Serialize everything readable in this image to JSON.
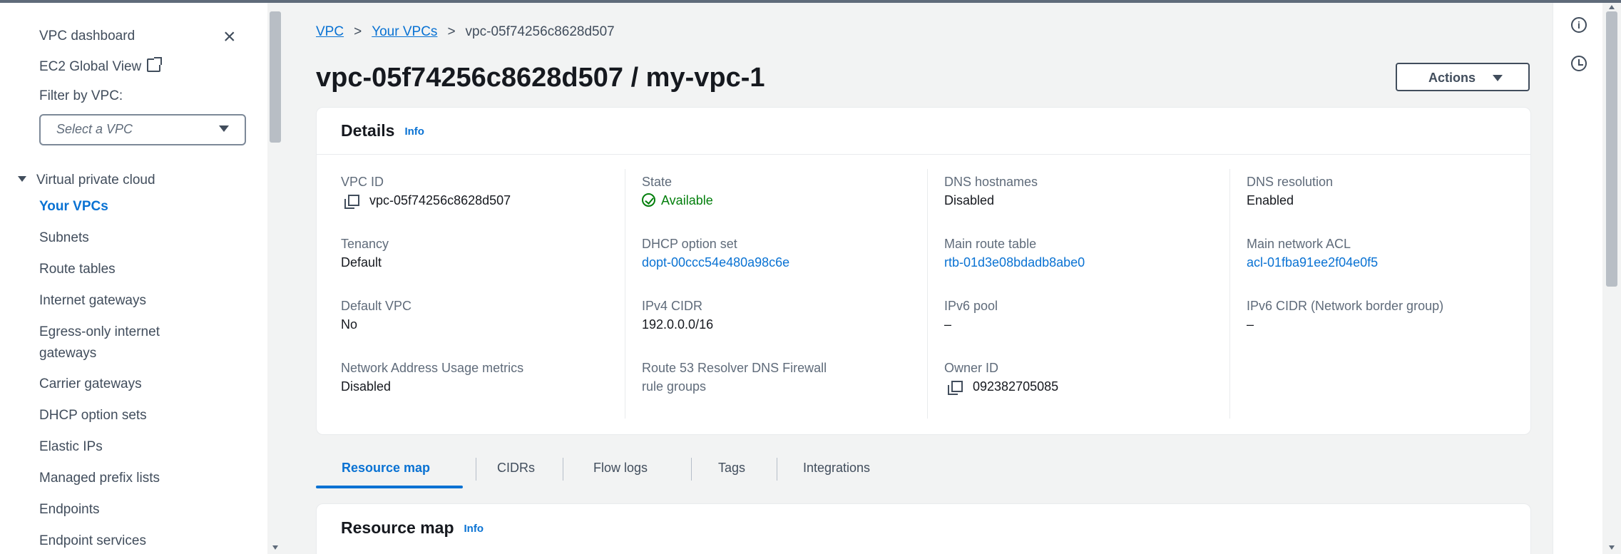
{
  "sidebar": {
    "dashboard_label": "VPC dashboard",
    "ec2_global_view_label": "EC2 Global View",
    "filter_label": "Filter by VPC:",
    "filter_select_value": "Select a VPC",
    "section_label": "Virtual private cloud",
    "items": [
      {
        "label": "Your VPCs",
        "active": true
      },
      {
        "label": "Subnets"
      },
      {
        "label": "Route tables"
      },
      {
        "label": "Internet gateways"
      },
      {
        "label": "Egress-only internet"
      },
      {
        "label": "gateways"
      },
      {
        "label": "Carrier gateways"
      },
      {
        "label": "DHCP option sets"
      },
      {
        "label": "Elastic IPs"
      },
      {
        "label": "Managed prefix lists"
      },
      {
        "label": "Endpoints"
      },
      {
        "label": "Endpoint services"
      }
    ]
  },
  "breadcrumb": {
    "items": [
      "VPC",
      "Your VPCs",
      "vpc-05f74256c8628d507"
    ],
    "separator": ">"
  },
  "page": {
    "title": "vpc-05f74256c8628d507 / my-vpc-1",
    "actions_label": "Actions"
  },
  "details": {
    "title": "Details",
    "info_label": "Info",
    "fields": {
      "vpc_id": {
        "label": "VPC ID",
        "value": "vpc-05f74256c8628d507"
      },
      "state": {
        "label": "State",
        "value": "Available"
      },
      "dns_hostnames": {
        "label": "DNS hostnames",
        "value": "Disabled"
      },
      "dns_resolution": {
        "label": "DNS resolution",
        "value": "Enabled"
      },
      "tenancy": {
        "label": "Tenancy",
        "value": "Default"
      },
      "dhcp_option_set": {
        "label": "DHCP option set",
        "value": "dopt-00ccc54e480a98c6e"
      },
      "main_route_table": {
        "label": "Main route table",
        "value": "rtb-01d3e08bdadb8abe0"
      },
      "main_network_acl": {
        "label": "Main network ACL",
        "value": "acl-01fba91ee2f04e0f5"
      },
      "default_vpc": {
        "label": "Default VPC",
        "value": "No"
      },
      "ipv4_cidr": {
        "label": "IPv4 CIDR",
        "value": "192.0.0.0/16"
      },
      "ipv6_pool": {
        "label": "IPv6 pool",
        "value": "–"
      },
      "ipv6_cidr": {
        "label": "IPv6 CIDR (Network border group)",
        "value": "–"
      },
      "nau_metrics": {
        "label": "Network Address Usage metrics",
        "value": "Disabled"
      },
      "route53_firewall": {
        "label_line1": "Route 53 Resolver DNS Firewall",
        "label_line2": "rule groups"
      },
      "owner_id": {
        "label": "Owner ID",
        "value": "092382705085"
      }
    }
  },
  "tabs": [
    {
      "label": "Resource map",
      "active": true
    },
    {
      "label": "CIDRs"
    },
    {
      "label": "Flow logs"
    },
    {
      "label": "Tags"
    },
    {
      "label": "Integrations"
    }
  ],
  "resource_map": {
    "title": "Resource map",
    "info_label": "Info"
  },
  "rail": {
    "info_icon_glyph": "i"
  },
  "colors": {
    "link": "#0972d3",
    "success": "#037f0c",
    "text": "#16191f",
    "muted": "#5f6b7a",
    "background": "#f2f3f3"
  }
}
